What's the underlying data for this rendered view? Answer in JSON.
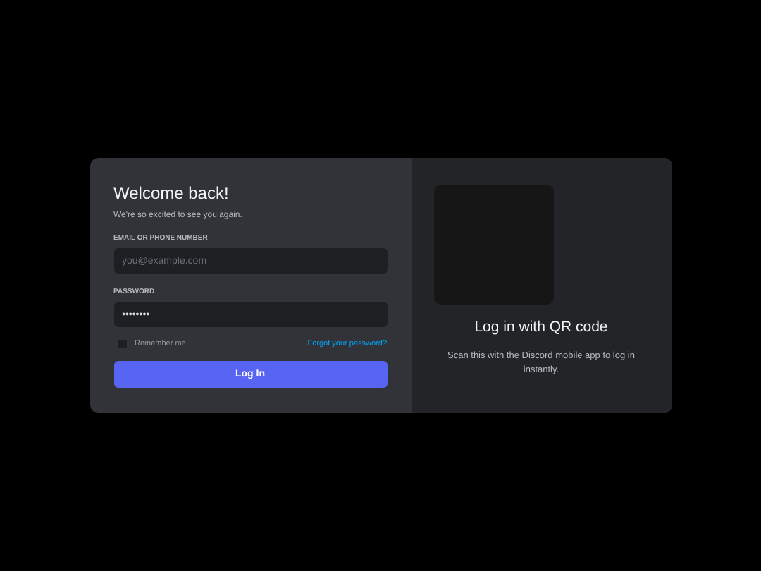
{
  "login": {
    "title": "Welcome back!",
    "subtitle": "We're so excited to see you again.",
    "fields": [
      {
        "label": "EMAIL OR PHONE NUMBER",
        "placeholder": "you@example.com"
      },
      {
        "label": "PASSWORD",
        "value": "••••••••"
      }
    ],
    "remember": {
      "label": "Remember me",
      "checked": false
    },
    "forgot_link": "Forgot your password?",
    "button": "Log In"
  },
  "qr": {
    "title": "Log in with QR code",
    "description": "Scan this with the Discord mobile app to log in instantly."
  }
}
